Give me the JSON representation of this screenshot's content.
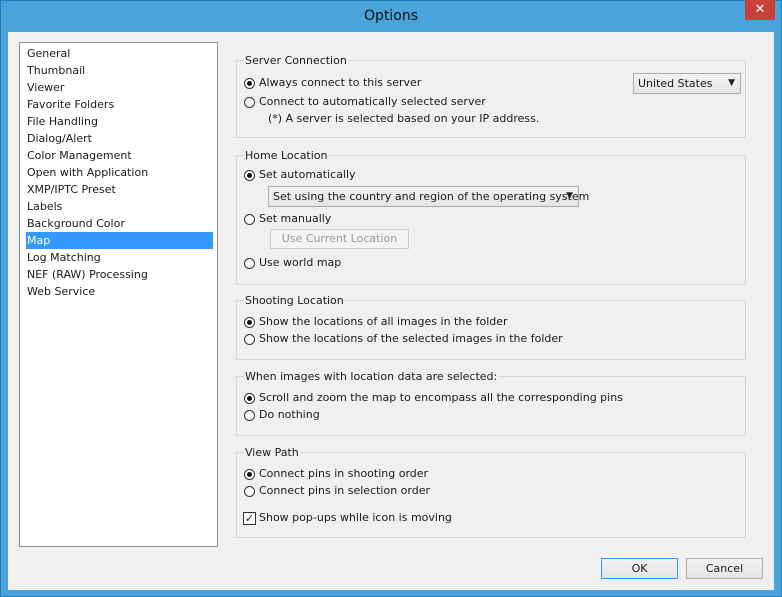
{
  "window": {
    "title": "Options",
    "close_glyph": "✕"
  },
  "nav": {
    "items": [
      {
        "label": "General"
      },
      {
        "label": "Thumbnail"
      },
      {
        "label": "Viewer"
      },
      {
        "label": "Favorite Folders"
      },
      {
        "label": "File Handling"
      },
      {
        "label": "Dialog/Alert"
      },
      {
        "label": "Color Management"
      },
      {
        "label": "Open with Application"
      },
      {
        "label": "XMP/IPTC Preset"
      },
      {
        "label": "Labels"
      },
      {
        "label": "Background Color"
      },
      {
        "label": "Map"
      },
      {
        "label": "Log Matching"
      },
      {
        "label": "NEF (RAW) Processing"
      },
      {
        "label": "Web Service"
      }
    ],
    "selected": "Map"
  },
  "server": {
    "title": "Server Connection",
    "opt_always": "Always connect to this server",
    "opt_auto": "Connect to automatically selected server",
    "note": "(*) A server is selected based on your IP address.",
    "country_value": "United States",
    "selected": "always"
  },
  "home": {
    "title": "Home Location",
    "opt_auto": "Set automatically",
    "auto_select_value": "Set using the country and region of the operating system",
    "opt_manual": "Set manually",
    "use_current_label": "Use Current Location",
    "opt_world": "Use world map",
    "selected": "auto"
  },
  "shooting": {
    "title": "Shooting Location",
    "opt_all": "Show the locations of all images in the folder",
    "opt_selected": "Show the locations of the selected images in the folder",
    "selected": "all"
  },
  "when_selected": {
    "title": "When images with location data are selected:",
    "opt_scroll": "Scroll and zoom the map to encompass all the corresponding pins",
    "opt_nothing": "Do nothing",
    "selected": "scroll"
  },
  "view_path": {
    "title": "View Path",
    "opt_shooting": "Connect pins in shooting order",
    "opt_selection": "Connect pins in selection order",
    "popup_label": "Show pop-ups while icon is moving",
    "popup_checked": true,
    "selected": "shooting"
  },
  "footer": {
    "ok_label": "OK",
    "cancel_label": "Cancel"
  },
  "colors": {
    "titlebar": "#4aa3db",
    "selection": "#3399ff",
    "close": "#c7413a"
  }
}
